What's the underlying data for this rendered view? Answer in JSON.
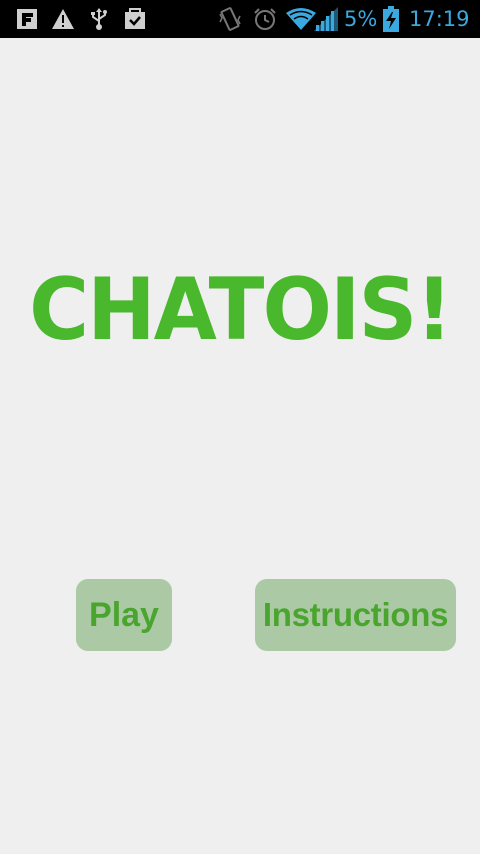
{
  "status_bar": {
    "icons": [
      "flipboard-icon",
      "warning-icon",
      "usb-icon",
      "clipboard-check-icon",
      "vibrate-icon",
      "alarm-icon",
      "wifi-icon",
      "cell-signal-icon",
      "battery-charging-icon"
    ],
    "battery_percent": "5%",
    "time": "17:19",
    "accent_color": "#39a9e0"
  },
  "main": {
    "title": "CHATOIS!",
    "title_color": "#49b82c",
    "buttons": {
      "play_label": "Play",
      "instructions_label": "Instructions"
    },
    "button_bg_color": "#abc9a4",
    "button_text_color": "#4aa52e"
  }
}
